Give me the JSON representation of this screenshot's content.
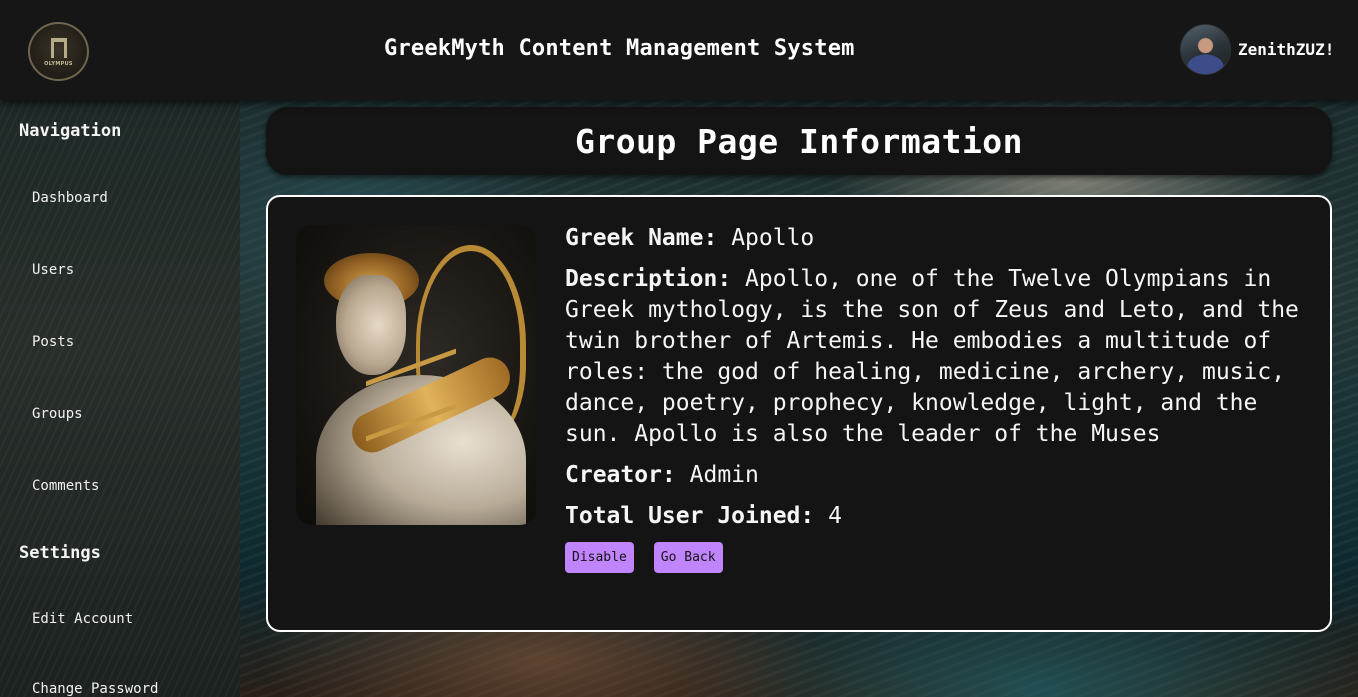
{
  "app": {
    "title": "GreekMyth Content Management System",
    "logo_text": "OLYMPUS"
  },
  "user": {
    "name": "ZenithZUZ!"
  },
  "sidebar": {
    "nav_heading": "Navigation",
    "nav_items": [
      {
        "label": "Dashboard"
      },
      {
        "label": "Users"
      },
      {
        "label": "Posts"
      },
      {
        "label": "Groups"
      },
      {
        "label": "Comments"
      }
    ],
    "settings_heading": "Settings",
    "settings_items": [
      {
        "label": "Edit Account"
      },
      {
        "label": "Change Password"
      }
    ]
  },
  "page": {
    "heading": "Group Page Information"
  },
  "group": {
    "greek_name_label": "Greek Name:",
    "greek_name": "Apollo",
    "description_label": "Description:",
    "description": "Apollo, one of the Twelve Olympians in Greek mythology, is the son of Zeus and Leto, and the twin brother of Artemis. He embodies a multitude of roles: the god of healing, medicine, archery, music, dance, poetry, prophecy, knowledge, light, and the sun. Apollo is also the leader of the Muses",
    "creator_label": "Creator:",
    "creator": "Admin",
    "total_joined_label": "Total User Joined:",
    "total_joined": "4"
  },
  "actions": {
    "disable_label": "Disable",
    "back_label": "Go Back"
  },
  "colors": {
    "button_bg": "#c084fc",
    "card_bg": "#141414",
    "topbar_bg": "#161616"
  }
}
